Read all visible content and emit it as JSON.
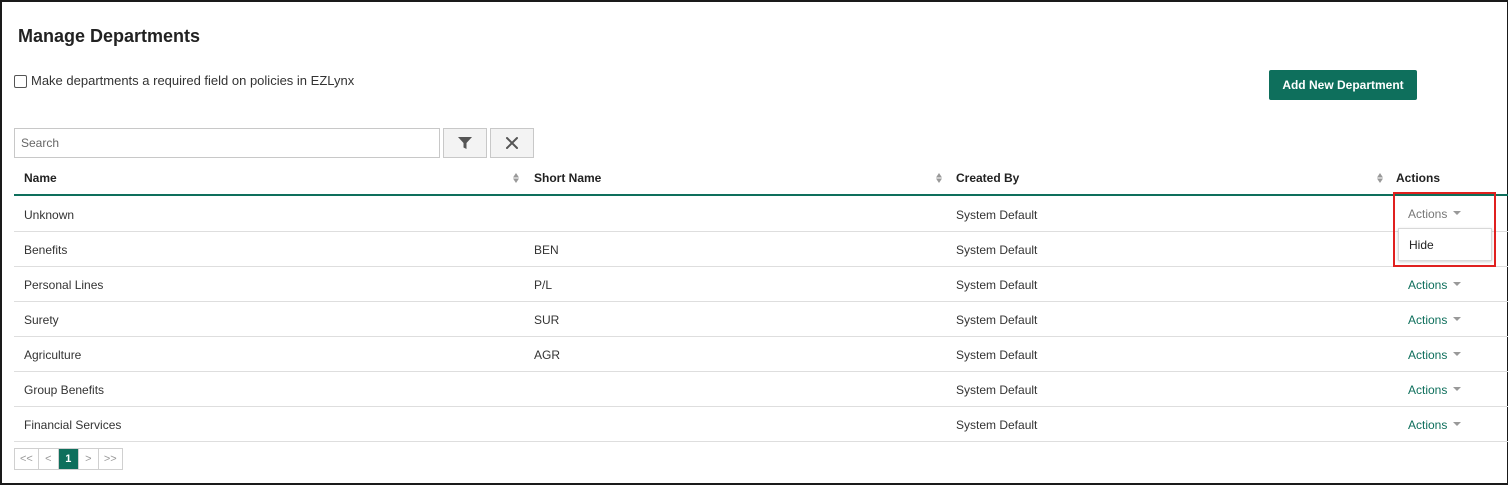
{
  "page": {
    "title": "Manage Departments",
    "required_checkbox_label": "Make departments a required field on policies in EZLynx",
    "add_button_label": "Add New Department"
  },
  "search": {
    "placeholder": "Search",
    "value": ""
  },
  "table": {
    "columns": [
      "Name",
      "Short Name",
      "Created By",
      "Actions"
    ],
    "rows": [
      {
        "name": "Unknown",
        "short_name": "",
        "created_by": "System Default",
        "actions": "Actions"
      },
      {
        "name": "Benefits",
        "short_name": "BEN",
        "created_by": "System Default",
        "actions": "Actions"
      },
      {
        "name": "Personal Lines",
        "short_name": "P/L",
        "created_by": "System Default",
        "actions": "Actions"
      },
      {
        "name": "Surety",
        "short_name": "SUR",
        "created_by": "System Default",
        "actions": "Actions"
      },
      {
        "name": "Agriculture",
        "short_name": "AGR",
        "created_by": "System Default",
        "actions": "Actions"
      },
      {
        "name": "Group Benefits",
        "short_name": "",
        "created_by": "System Default",
        "actions": "Actions"
      },
      {
        "name": "Financial Services",
        "short_name": "",
        "created_by": "System Default",
        "actions": "Actions"
      }
    ]
  },
  "actions_menu": {
    "items": [
      "Hide"
    ]
  },
  "pagination": {
    "first": "<<",
    "prev": "<",
    "current": "1",
    "next": ">",
    "last": ">>"
  },
  "colors": {
    "brand": "#0e6f5c",
    "highlight": "#e0201f"
  },
  "icons": [
    "filter-icon",
    "close-icon",
    "sort-icon",
    "caret-down-icon"
  ]
}
